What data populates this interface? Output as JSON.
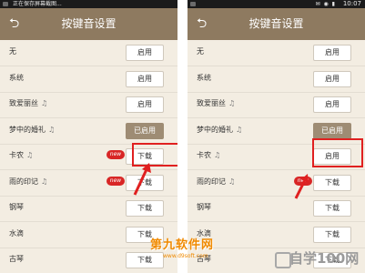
{
  "left": {
    "status": {
      "text": "正在保存屏幕截图...",
      "time": "",
      "icons": ""
    },
    "header": {
      "title": "按键音设置",
      "back": "⮌"
    },
    "rows": [
      {
        "label": "无",
        "note": "",
        "button": "启用",
        "active": false,
        "badge": ""
      },
      {
        "label": "系统",
        "note": "",
        "button": "启用",
        "active": false,
        "badge": ""
      },
      {
        "label": "致爱丽丝",
        "note": "♫",
        "button": "启用",
        "active": false,
        "badge": ""
      },
      {
        "label": "梦中的婚礼",
        "note": "♫",
        "button": "已启用",
        "active": true,
        "badge": ""
      },
      {
        "label": "卡农",
        "note": "♫",
        "button": "下载",
        "active": false,
        "badge": "new"
      },
      {
        "label": "雨的印记",
        "note": "♫",
        "button": "下载",
        "active": false,
        "badge": "new"
      },
      {
        "label": "钢琴",
        "note": "",
        "button": "下载",
        "active": false,
        "badge": ""
      },
      {
        "label": "水滴",
        "note": "",
        "button": "下载",
        "active": false,
        "badge": ""
      },
      {
        "label": "古琴",
        "note": "",
        "button": "下载",
        "active": false,
        "badge": ""
      }
    ]
  },
  "right": {
    "status": {
      "text": "",
      "time": "10:07",
      "icons": "✉ ◉ ▮"
    },
    "header": {
      "title": "按键音设置",
      "back": "⮌"
    },
    "rows": [
      {
        "label": "无",
        "note": "",
        "button": "启用",
        "active": false,
        "badge": ""
      },
      {
        "label": "系统",
        "note": "",
        "button": "启用",
        "active": false,
        "badge": ""
      },
      {
        "label": "致爱丽丝",
        "note": "♫",
        "button": "启用",
        "active": false,
        "badge": ""
      },
      {
        "label": "梦中的婚礼",
        "note": "♫",
        "button": "已启用",
        "active": true,
        "badge": ""
      },
      {
        "label": "卡农",
        "note": "♫",
        "button": "启用",
        "active": false,
        "badge": ""
      },
      {
        "label": "雨的印记",
        "note": "♫",
        "button": "下载",
        "active": false,
        "badge": "new"
      },
      {
        "label": "钢琴",
        "note": "",
        "button": "下载",
        "active": false,
        "badge": ""
      },
      {
        "label": "水滴",
        "note": "",
        "button": "下载",
        "active": false,
        "badge": ""
      },
      {
        "label": "古琴",
        "note": "",
        "button": "下载",
        "active": false,
        "badge": ""
      }
    ]
  },
  "watermarks": {
    "site1_title": "第九软件网",
    "site1_sub": "www.d9soft.com",
    "site2": "自学100网"
  },
  "colors": {
    "header": "#8e7a60",
    "background": "#f3ede2",
    "active_button": "#9e8c74",
    "highlight": "#e02020",
    "badge": "#d82626"
  }
}
